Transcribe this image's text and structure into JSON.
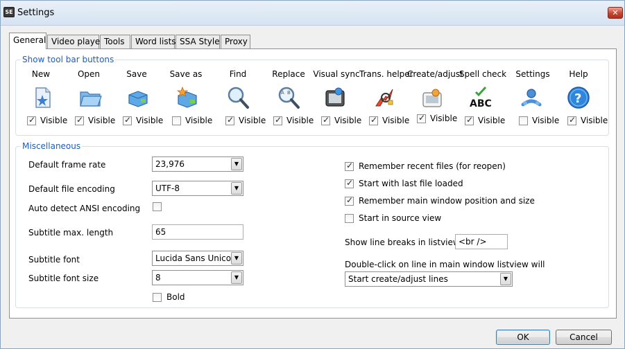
{
  "window": {
    "title": "Settings",
    "app_icon_text": "SE"
  },
  "tabs": [
    {
      "label": "General",
      "active": true
    },
    {
      "label": "Video player"
    },
    {
      "label": "Tools"
    },
    {
      "label": "Word lists"
    },
    {
      "label": "SSA Style"
    },
    {
      "label": "Proxy"
    }
  ],
  "toolbar_group": {
    "title": "Show tool bar buttons",
    "items": [
      {
        "label": "New",
        "icon": "new-file-icon",
        "visible": true
      },
      {
        "label": "Open",
        "icon": "open-folder-icon",
        "visible": true
      },
      {
        "label": "Save",
        "icon": "save-icon",
        "visible": true
      },
      {
        "label": "Save as",
        "icon": "save-as-icon",
        "visible": false
      },
      {
        "label": "Find",
        "icon": "magnifier-icon",
        "visible": true
      },
      {
        "label": "Replace",
        "icon": "replace-icon",
        "visible": true
      },
      {
        "label": "Visual sync",
        "icon": "visual-sync-icon",
        "visible": true
      },
      {
        "label": "Trans. helper",
        "icon": "translate-helper-icon",
        "visible": true
      },
      {
        "label": "Create/adjust",
        "icon": "create-adjust-icon",
        "visible": true
      },
      {
        "label": "Spell check",
        "icon": "spell-check-icon",
        "visible": true
      },
      {
        "label": "Settings",
        "icon": "settings-icon",
        "visible": false
      },
      {
        "label": "Help",
        "icon": "help-icon",
        "visible": true
      }
    ],
    "visible_label": "Visible",
    "spell_icon_text": "ABC"
  },
  "misc": {
    "title": "Miscellaneous",
    "frame_rate": {
      "label": "Default frame rate",
      "value": "23,976"
    },
    "file_encoding": {
      "label": "Default file encoding",
      "value": "UTF-8"
    },
    "auto_detect": {
      "label": "Auto detect ANSI encoding",
      "checked": false
    },
    "max_length": {
      "label": "Subtitle max. length",
      "value": "65"
    },
    "font": {
      "label": "Subtitle font",
      "value": "Lucida Sans Unicode"
    },
    "font_size": {
      "label": "Subtitle font size",
      "value": "8"
    },
    "bold": {
      "label": "Bold",
      "checked": false
    },
    "remember_recent": {
      "label": "Remember recent files (for reopen)",
      "checked": true
    },
    "start_last": {
      "label": "Start with last file loaded",
      "checked": true
    },
    "remember_pos": {
      "label": "Remember main window position and size",
      "checked": true
    },
    "source_view": {
      "label": "Start in source view",
      "checked": false
    },
    "line_breaks": {
      "label": "Show line breaks in listview as",
      "value": "<br />"
    },
    "double_click": {
      "label": "Double-click on line in main window listview will",
      "value": "Start create/adjust lines"
    }
  },
  "buttons": {
    "ok": "OK",
    "cancel": "Cancel",
    "close_glyph": "✕",
    "dropdown_glyph": "▼"
  }
}
